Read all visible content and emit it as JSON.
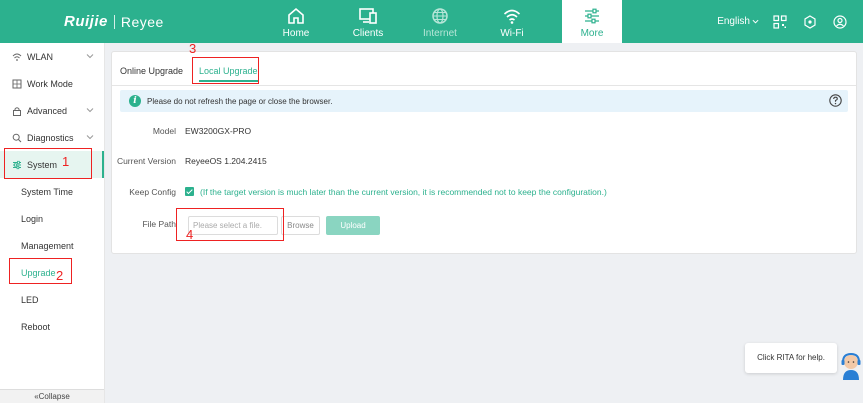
{
  "brand": {
    "logo_left": "Ruijie",
    "logo_right": "Reyee"
  },
  "nav": [
    {
      "label": "Home",
      "icon": "home-icon"
    },
    {
      "label": "Clients",
      "icon": "monitor-icon"
    },
    {
      "label": "Internet",
      "icon": "globe-icon",
      "state": "disabled"
    },
    {
      "label": "Wi-Fi",
      "icon": "wifi-icon"
    },
    {
      "label": "More",
      "icon": "sliders-icon",
      "state": "active"
    }
  ],
  "header_right": {
    "language": "English"
  },
  "sidebar": {
    "items": [
      {
        "label": "WLAN",
        "icon": "wifi-icon",
        "expandable": true
      },
      {
        "label": "Work Mode",
        "icon": "grid-icon",
        "expandable": false
      },
      {
        "label": "Advanced",
        "icon": "lock-icon",
        "expandable": true
      },
      {
        "label": "Diagnostics",
        "icon": "search-icon",
        "expandable": true
      },
      {
        "label": "System",
        "icon": "sliders-icon",
        "expandable": true,
        "state": "expanded"
      }
    ],
    "subitems": [
      {
        "label": "System Time"
      },
      {
        "label": "Login"
      },
      {
        "label": "Management"
      },
      {
        "label": "Upgrade",
        "state": "active"
      },
      {
        "label": "LED"
      },
      {
        "label": "Reboot"
      }
    ],
    "collapse_label": "«Collapse"
  },
  "tabs": {
    "online": "Online Upgrade",
    "local": "Local Upgrade"
  },
  "notice": {
    "text": "Please do not refresh the page or close the browser."
  },
  "form": {
    "model_label": "Model",
    "model_value": "EW3200GX-PRO",
    "version_label": "Current Version",
    "version_value": "ReyeeOS 1.204.2415",
    "keep_label": "Keep Config",
    "keep_hint": "(If the target version is much later than the current version, it is recommended not to keep the configuration.)",
    "file_label": "File Path",
    "file_placeholder": "Please select a file.",
    "browse_label": "Browse",
    "upload_label": "Upload"
  },
  "annotations": {
    "n1": "1",
    "n2": "2",
    "n3": "3",
    "n4": "4"
  },
  "help": {
    "text": "Click RITA for help."
  },
  "colors": {
    "brand_green": "#2cb18e",
    "annotation_red": "#e22",
    "notice_bg": "#e6f3fb"
  }
}
